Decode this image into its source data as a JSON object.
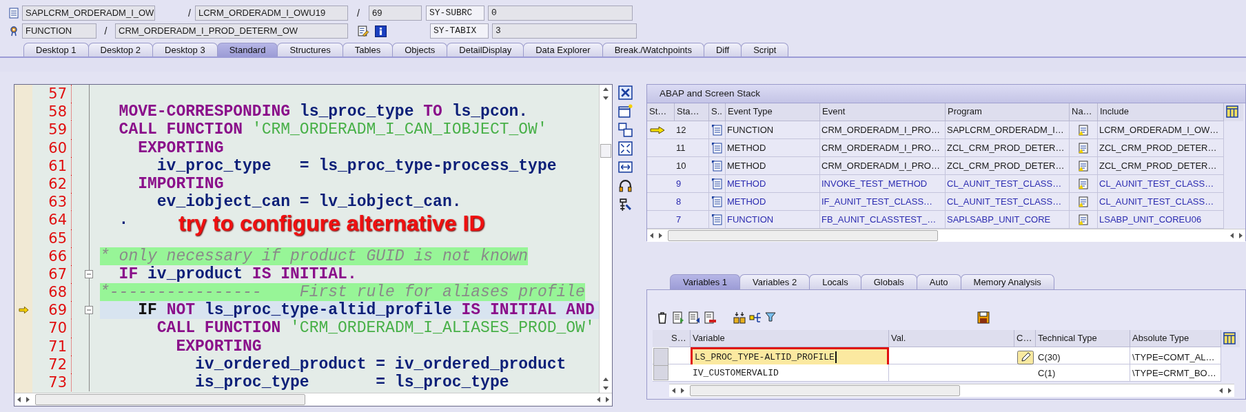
{
  "header": {
    "program": "SAPLCRM_ORDERADM_I_OW",
    "separators": [
      "/",
      "/",
      "/"
    ],
    "include": "LCRM_ORDERADM_I_OWU19",
    "line": "69",
    "event_type": "FUNCTION",
    "event": "CRM_ORDERADM_I_PROD_DETERM_OW",
    "system_fields": [
      {
        "name": "SY-SUBRC",
        "value": "0"
      },
      {
        "name": "SY-TABIX",
        "value": "3"
      }
    ]
  },
  "tabs": [
    {
      "label": "Desktop 1",
      "selected": false
    },
    {
      "label": "Desktop 2",
      "selected": false
    },
    {
      "label": "Desktop 3",
      "selected": false
    },
    {
      "label": "Standard",
      "selected": true
    },
    {
      "label": "Structures",
      "selected": false
    },
    {
      "label": "Tables",
      "selected": false
    },
    {
      "label": "Objects",
      "selected": false
    },
    {
      "label": "DetailDisplay",
      "selected": false
    },
    {
      "label": "Data Explorer",
      "selected": false
    },
    {
      "label": "Break./Watchpoints",
      "selected": false
    },
    {
      "label": "Diff",
      "selected": false
    },
    {
      "label": "Script",
      "selected": false
    }
  ],
  "code": {
    "lines": [
      {
        "number": "57",
        "fold": false,
        "current": false
      },
      {
        "number": "58",
        "fold": false,
        "current": false,
        "tokens": [
          {
            "text": "  MOVE-CORRESPONDING",
            "kind": "kw"
          },
          {
            "text": " ls_proc_type ",
            "kind": "id"
          },
          {
            "text": "TO",
            "kind": "kw"
          },
          {
            "text": " ls_pcon.",
            "kind": "id"
          }
        ]
      },
      {
        "number": "59",
        "fold": false,
        "current": false,
        "tokens": [
          {
            "text": "  CALL FUNCTION",
            "kind": "kw"
          },
          {
            "text": " 'CRM_ORDERADM_I_CAN_IOBJECT_OW'",
            "kind": "str"
          }
        ]
      },
      {
        "number": "60",
        "fold": false,
        "current": false,
        "tokens": [
          {
            "text": "    EXPORTING",
            "kind": "kw"
          }
        ]
      },
      {
        "number": "61",
        "fold": false,
        "current": false,
        "tokens": [
          {
            "text": "      iv_proc_type   = ls_proc_type-process_type",
            "kind": "id"
          }
        ]
      },
      {
        "number": "62",
        "fold": false,
        "current": false,
        "tokens": [
          {
            "text": "    IMPORTING",
            "kind": "kw"
          }
        ]
      },
      {
        "number": "63",
        "fold": false,
        "current": false,
        "tokens": [
          {
            "text": "      ev_iobject_can = lv_iobject_can.",
            "kind": "id"
          }
        ]
      },
      {
        "number": "64",
        "fold": false,
        "current": false,
        "tokens": [
          {
            "text": "  .",
            "kind": "id"
          }
        ]
      },
      {
        "number": "65",
        "fold": false,
        "current": false
      },
      {
        "number": "66",
        "fold": false,
        "current": false,
        "tokens": [
          {
            "text": "* only necessary if product GUID is not known",
            "kind": "comment"
          }
        ]
      },
      {
        "number": "67",
        "fold": true,
        "current": false,
        "tokens": [
          {
            "text": "  IF",
            "kind": "kw"
          },
          {
            "text": " iv_product ",
            "kind": "id"
          },
          {
            "text": "IS INITIAL.",
            "kind": "kw"
          }
        ]
      },
      {
        "number": "68",
        "fold": false,
        "current": false,
        "tokens": [
          {
            "text": "*----------------    First rule for aliases profile",
            "kind": "comment"
          }
        ]
      },
      {
        "number": "69",
        "fold": true,
        "current": true,
        "tokens": [
          {
            "text": "    IF",
            "kind": "plain"
          },
          {
            "text": " NOT",
            "kind": "kw"
          },
          {
            "text": " ls_proc_type-altid_profile ",
            "kind": "id"
          },
          {
            "text": "IS INITIAL AND",
            "kind": "kw"
          }
        ]
      },
      {
        "number": "70",
        "fold": false,
        "current": false,
        "tokens": [
          {
            "text": "      CALL FUNCTION",
            "kind": "kw"
          },
          {
            "text": " 'CRM_ORDERADM_I_ALIASES_PROD_OW'",
            "kind": "str"
          }
        ]
      },
      {
        "number": "71",
        "fold": false,
        "current": false,
        "tokens": [
          {
            "text": "        EXPORTING",
            "kind": "kw"
          }
        ]
      },
      {
        "number": "72",
        "fold": false,
        "current": false,
        "tokens": [
          {
            "text": "          iv_ordered_product = iv_ordered_product",
            "kind": "id"
          }
        ]
      },
      {
        "number": "73",
        "fold": false,
        "current": false,
        "tokens": [
          {
            "text": "          is_proc_type       = ls_proc_type",
            "kind": "id"
          }
        ]
      }
    ]
  },
  "annotation": {
    "text": "try to configure alternative ID"
  },
  "stack": {
    "title": "ABAP and Screen Stack",
    "columns": [
      "St…",
      "Sta…",
      "S..",
      "Event Type",
      "Event",
      "Program",
      "Na…",
      "Include"
    ],
    "rows": [
      {
        "current": true,
        "stack_level": "12",
        "event_type": "FUNCTION",
        "event": "CRM_ORDERADM_I_PRO…",
        "program": "SAPLCRM_ORDERADM_I…",
        "include": "LCRM_ORDERADM_I_OW…",
        "color": "#1a1a1a"
      },
      {
        "current": false,
        "stack_level": "11",
        "event_type": "METHOD",
        "event": "CRM_ORDERADM_I_PRO…",
        "program": "ZCL_CRM_PROD_DETER…",
        "include": "ZCL_CRM_PROD_DETER…",
        "color": "#1a1a1a"
      },
      {
        "current": false,
        "stack_level": "10",
        "event_type": "METHOD",
        "event": "CRM_ORDERADM_I_PRO…",
        "program": "ZCL_CRM_PROD_DETER…",
        "include": "ZCL_CRM_PROD_DETER…",
        "color": "#1a1a1a"
      },
      {
        "current": false,
        "stack_level": "9",
        "event_type": "METHOD",
        "event": "INVOKE_TEST_METHOD",
        "program": "CL_AUNIT_TEST_CLASS…",
        "include": "CL_AUNIT_TEST_CLASS…",
        "color": "#2b2bb0"
      },
      {
        "current": false,
        "stack_level": "8",
        "event_type": "METHOD",
        "event": "IF_AUNIT_TEST_CLASS…",
        "program": "CL_AUNIT_TEST_CLASS…",
        "include": "CL_AUNIT_TEST_CLASS…",
        "color": "#2b2bb0"
      },
      {
        "current": false,
        "stack_level": "7",
        "event_type": "FUNCTION",
        "event": "FB_AUNIT_CLASSTEST_…",
        "program": "SAPLSABP_UNIT_CORE",
        "include": "LSABP_UNIT_COREU06",
        "color": "#2b2bb0"
      }
    ]
  },
  "variables": {
    "tabs": [
      {
        "label": "Variables 1",
        "selected": true
      },
      {
        "label": "Variables 2",
        "selected": false
      },
      {
        "label": "Locals",
        "selected": false
      },
      {
        "label": "Globals",
        "selected": false
      },
      {
        "label": "Auto",
        "selected": false
      },
      {
        "label": "Memory Analysis",
        "selected": false
      }
    ],
    "columns": [
      "S…",
      "Variable",
      "Val.",
      "C…",
      "Technical Type",
      "Absolute Type"
    ],
    "rows": [
      {
        "variable": "LS_PROC_TYPE-ALTID_PROFILE",
        "technical_type": "C(30)",
        "absolute_type": "\\TYPE=COMT_AL…",
        "editing": true,
        "marked": true
      },
      {
        "variable": "IV_CUSTOMERVALID",
        "technical_type": "C(1)",
        "absolute_type": "\\TYPE=CRMT_BO…",
        "editing": false,
        "marked": false
      }
    ]
  }
}
